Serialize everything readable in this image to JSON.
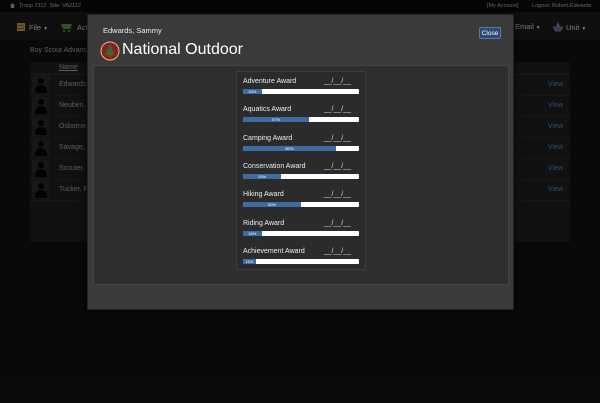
{
  "topbar": {
    "troop": "Troop 2112",
    "site": "Site: VA2112",
    "my_account": "[My Account]",
    "logout": "Logout: Robert.Edwards"
  },
  "navbar": {
    "file": "File",
    "act": "Act",
    "email": "Email",
    "unit": "Unit"
  },
  "background": {
    "title": "Boy Scout Advanc",
    "name_header": "Name",
    "rows": [
      {
        "name": "Edwards,",
        "action": "View"
      },
      {
        "name": "Neuben, I",
        "action": "View"
      },
      {
        "name": "Osborne,",
        "action": "View"
      },
      {
        "name": "Savage, E",
        "action": "View"
      },
      {
        "name": "Scouter,",
        "action": "View"
      },
      {
        "name": "Tucker, F",
        "action": "View"
      }
    ]
  },
  "modal": {
    "scout_name": "Edwards, Sammy",
    "close_label": "Close",
    "title": "National Outdoor",
    "awards": [
      {
        "name": "Adventure Award",
        "date": "__/__/__",
        "progress": 16,
        "progress_label": "16%"
      },
      {
        "name": "Aquatics Award",
        "date": "__/__/__",
        "progress": 57,
        "progress_label": "57%"
      },
      {
        "name": "Camping Award",
        "date": "__/__/__",
        "progress": 80,
        "progress_label": "80%"
      },
      {
        "name": "Conservation Award",
        "date": "__/__/__",
        "progress": 33,
        "progress_label": "33%"
      },
      {
        "name": "Hiking Award",
        "date": "__/__/__",
        "progress": 50,
        "progress_label": "50%"
      },
      {
        "name": "Riding Award",
        "date": "__/__/__",
        "progress": 16,
        "progress_label": "16%"
      },
      {
        "name": "Achievement Award",
        "date": "__/__/__",
        "progress": 11,
        "progress_label": "11%"
      }
    ]
  },
  "colors": {
    "bar_fill": "#3d6da0",
    "bar_track": "#ffffff",
    "link": "#5b8fd0",
    "close_button": "#2b4a75"
  }
}
